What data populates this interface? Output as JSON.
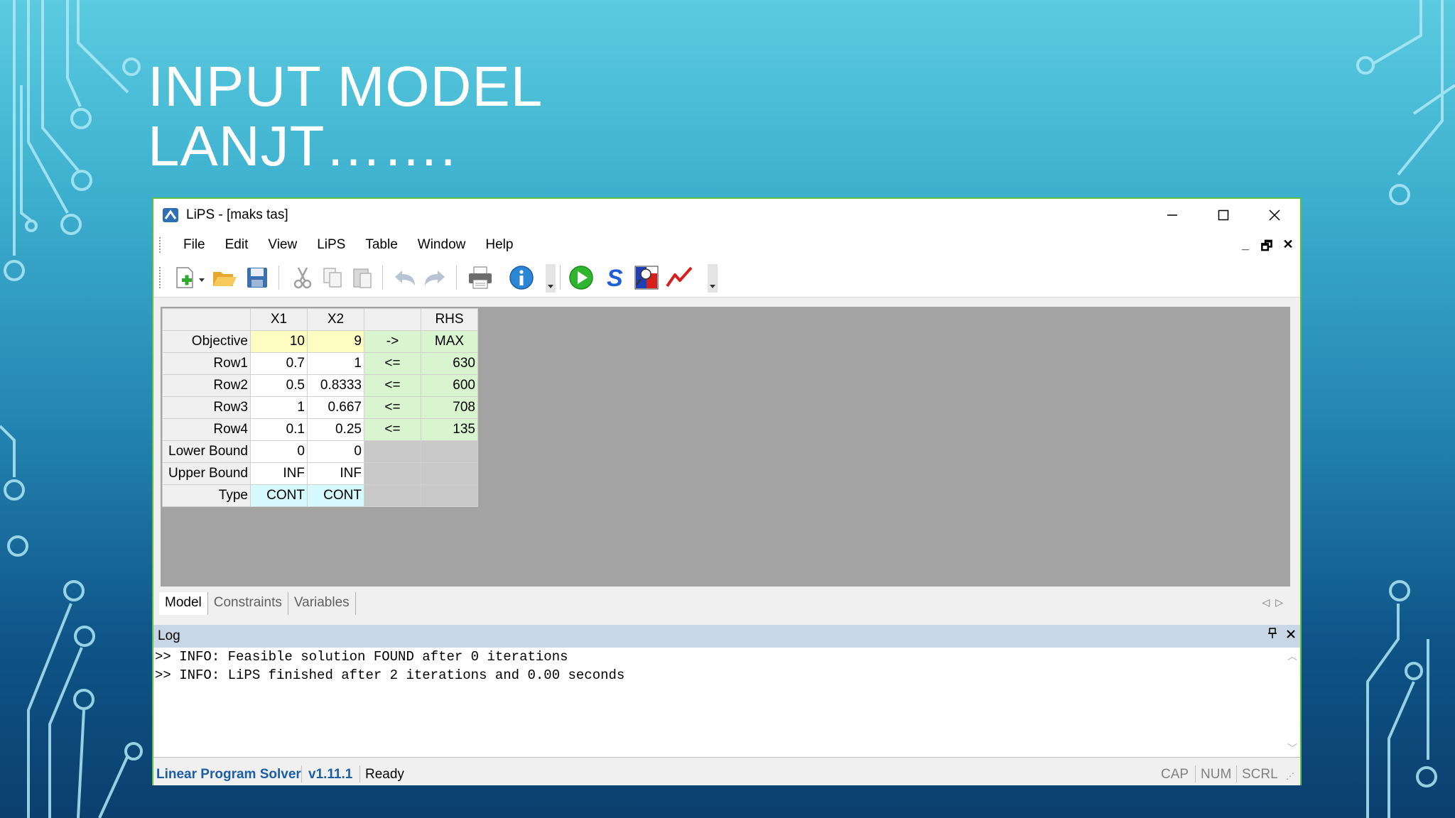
{
  "slide": {
    "title_line1": "INPUT MODEL",
    "title_line2": "LANJT……."
  },
  "window": {
    "title": "LiPS - [maks tas]",
    "controls": {
      "minimize": "—",
      "maximize": "☐",
      "close": "✕"
    }
  },
  "menu": {
    "items": [
      "File",
      "Edit",
      "View",
      "LiPS",
      "Table",
      "Window",
      "Help"
    ]
  },
  "mdi_controls": {
    "minimize": "_",
    "restore": "🗗",
    "close": "✕"
  },
  "toolbar": {
    "icons": [
      "new-icon",
      "open-icon",
      "save-icon",
      "cut-icon",
      "copy-icon",
      "paste-icon",
      "undo-icon",
      "redo-icon",
      "print-icon",
      "info-icon",
      "run-icon",
      "solve-s-icon",
      "sensitivity-icon",
      "graph-icon"
    ]
  },
  "grid": {
    "columns": [
      "",
      "X1",
      "X2",
      "",
      "RHS"
    ],
    "rows": [
      {
        "label": "Objective",
        "x1": "10",
        "x2": "9",
        "op": "->",
        "rhs": "MAX"
      },
      {
        "label": "Row1",
        "x1": "0.7",
        "x2": "1",
        "op": "<=",
        "rhs": "630"
      },
      {
        "label": "Row2",
        "x1": "0.5",
        "x2": "0.8333",
        "op": "<=",
        "rhs": "600"
      },
      {
        "label": "Row3",
        "x1": "1",
        "x2": "0.667",
        "op": "<=",
        "rhs": "708"
      },
      {
        "label": "Row4",
        "x1": "0.1",
        "x2": "0.25",
        "op": "<=",
        "rhs": "135"
      },
      {
        "label": "Lower Bound",
        "x1": "0",
        "x2": "0",
        "op": "",
        "rhs": ""
      },
      {
        "label": "Upper Bound",
        "x1": "INF",
        "x2": "INF",
        "op": "",
        "rhs": ""
      },
      {
        "label": "Type",
        "x1": "CONT",
        "x2": "CONT",
        "op": "",
        "rhs": ""
      }
    ]
  },
  "tabs": [
    "Model",
    "Constraints",
    "Variables"
  ],
  "log": {
    "title": "Log",
    "lines": [
      ">> INFO: Feasible solution FOUND after 0 iterations",
      ">> INFO: LiPS finished after 2 iterations and 0.00 seconds"
    ]
  },
  "status": {
    "app_name": "Linear Program Solver",
    "version": "v1.11.1",
    "state": "Ready",
    "cap": "CAP",
    "num": "NUM",
    "scrl": "SCRL"
  },
  "colors": {
    "window_border": "#5fbf3f",
    "objective_fill": "#fdfdc2",
    "rhs_fill": "#d8f5cf",
    "type_fill": "#d6f9fd",
    "status_blue": "#1c5ea6"
  }
}
